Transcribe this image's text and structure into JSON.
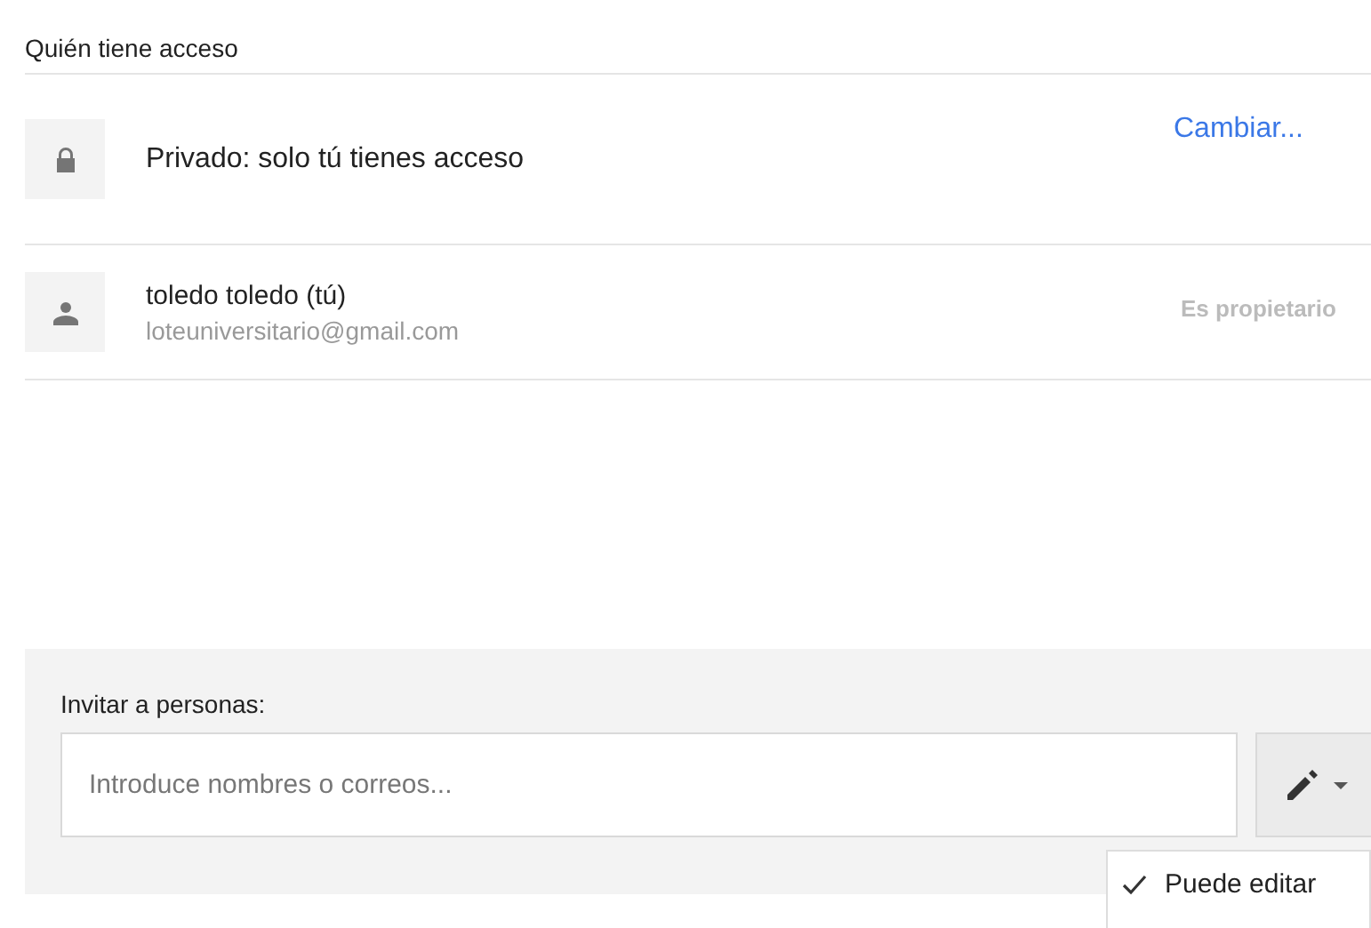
{
  "section_title": "Quién tiene acceso",
  "access_rows": [
    {
      "kind": "visibility",
      "text": "Privado: solo tú tienes acceso",
      "action": "Cambiar..."
    },
    {
      "kind": "person",
      "name": "toledo toledo (tú)",
      "email": "loteuniversitario@gmail.com",
      "role": "Es propietario"
    }
  ],
  "invite": {
    "label": "Invitar a personas:",
    "placeholder": "Introduce nombres o correos..."
  },
  "permission_menu": [
    {
      "label": "Puede editar",
      "selected": true
    }
  ]
}
